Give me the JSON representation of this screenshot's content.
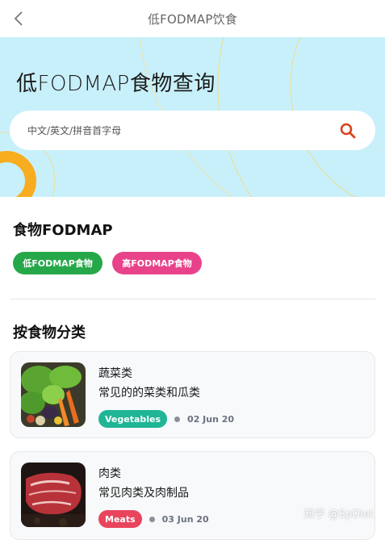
{
  "navbar": {
    "title": "低FODMAP饮食",
    "back_icon": "chevron-left-icon"
  },
  "hero": {
    "title": "低FODMAP食物查询",
    "search": {
      "placeholder": "中文/英文/拼音首字母",
      "value": "",
      "icon": "search-icon"
    },
    "colors": {
      "background": "#c8f0fb",
      "ring": "#f7ad1f",
      "search_icon": "#d9421b"
    }
  },
  "fodmap_section": {
    "title": "食物FODMAP",
    "buttons": [
      {
        "label": "低FODMAP食物",
        "color": "#26a84a"
      },
      {
        "label": "高FODMAP食物",
        "color": "#e8438a"
      }
    ]
  },
  "category_section": {
    "title": "按食物分类",
    "cards": [
      {
        "title": "蔬菜类",
        "description": "常见的的菜类和瓜类",
        "tag": "Vegetables",
        "tag_color": "#1fb595",
        "date": "02 Jun 20",
        "image": "vegetables-photo"
      },
      {
        "title": "肉类",
        "description": "常见肉类及肉制品",
        "tag": "Meats",
        "tag_color": "#e8455d",
        "date": "03 Jun 20",
        "image": "meat-photo"
      }
    ]
  },
  "watermark": "知乎 @SpDiet"
}
